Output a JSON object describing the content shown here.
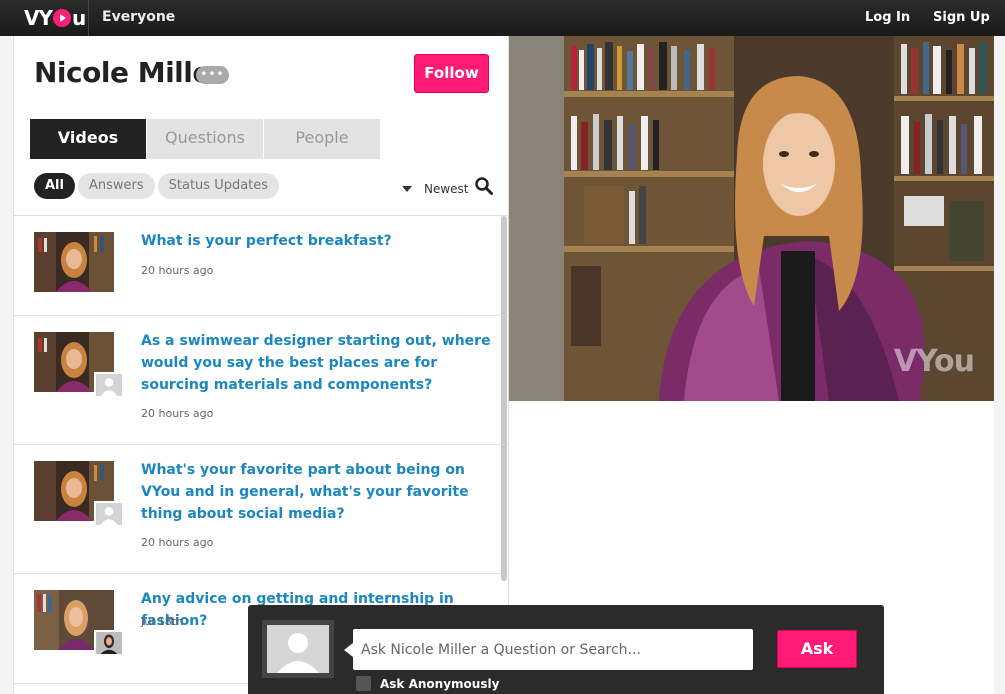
{
  "topbar": {
    "logo_text": "VYou",
    "scope": "Everyone",
    "login": "Log In",
    "signup": "Sign Up"
  },
  "profile": {
    "name": "Nicole Miller",
    "more": "•••",
    "follow": "Follow"
  },
  "tabs": [
    "Videos",
    "Questions",
    "People"
  ],
  "filters": [
    "All",
    "Answers",
    "Status Updates"
  ],
  "sort": {
    "label": "Newest"
  },
  "items": [
    {
      "title": "What is your perfect breakfast?",
      "time": "20 hours ago"
    },
    {
      "title": "As a swimwear designer starting out, where would you say the best places are for sourcing materials and components?",
      "time": "20 hours ago"
    },
    {
      "title": "What's your favorite part about being on VYou and in general, what's your favorite thing about social media?",
      "time": "20 hours ago"
    },
    {
      "title": "Any advice on getting and internship in fashion?",
      "time": "Jul 18th"
    }
  ],
  "video": {
    "watermark": "VYou"
  },
  "ask": {
    "placeholder": "Ask Nicole Miller a Question or Search...",
    "button": "Ask",
    "anonymous": "Ask Anonymously"
  },
  "colors": {
    "accent": "#ff1a73",
    "link": "#1b87bf",
    "dark": "#222222"
  }
}
